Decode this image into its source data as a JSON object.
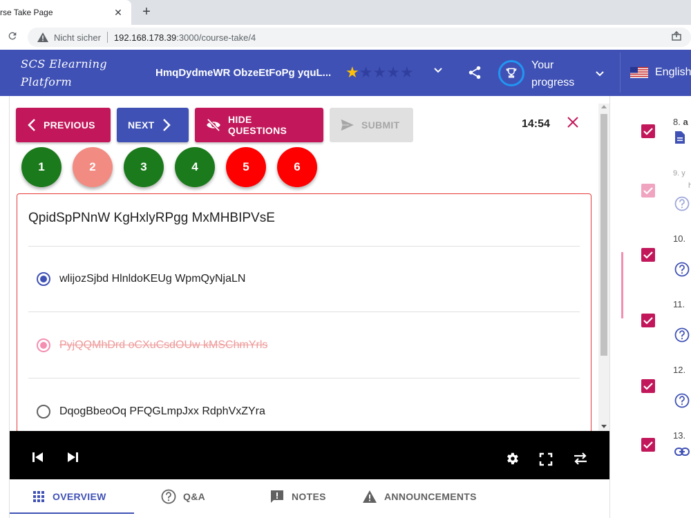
{
  "browser": {
    "tab_title": "rse Take Page",
    "tab_close": "✕",
    "new_tab": "+",
    "insecure_label": "Nicht sicher",
    "url_host": "192.168.178.39",
    "url_path": ":3000/course-take/4"
  },
  "header": {
    "logo_line1": "SCS Elearning",
    "logo_line2": "Platform",
    "course_title": "HmqDydmeWR ObzeEtFoPg yquL...",
    "rating": 1,
    "rating_max": 5,
    "progress_label": "Your progress",
    "language": "English",
    "colors": {
      "bar": "#3f51b5",
      "star_on": "#ffc107",
      "trophy_ring": "#2196f3"
    }
  },
  "toolbar": {
    "previous_label": "PREVIOUS",
    "next_label": "NEXT",
    "hide_questions_label": "HIDE QUESTIONS",
    "submit_label": "SUBMIT",
    "timer": "14:54"
  },
  "question_numbers": [
    {
      "label": "1",
      "status": "green"
    },
    {
      "label": "2",
      "status": "pink"
    },
    {
      "label": "3",
      "status": "green"
    },
    {
      "label": "4",
      "status": "green"
    },
    {
      "label": "5",
      "status": "red"
    },
    {
      "label": "6",
      "status": "red"
    }
  ],
  "question": {
    "title": "QpidSpPNnW KgHxlyRPgg MxMHBIPVsE",
    "answers": [
      {
        "text": "wlijozSjbd HlnldoKEUg WpmQyNjaLN",
        "state": "selected"
      },
      {
        "text": "PyjQQMhDrd oCXuCsdOUw kMSChmYrls",
        "state": "wrong"
      },
      {
        "text": "DqogBbeoOq PFQGLmpJxx RdphVxZYra",
        "state": "unselected"
      }
    ]
  },
  "bottom_tabs": [
    {
      "label": "OVERVIEW",
      "icon": "grid-icon",
      "active": true
    },
    {
      "label": "Q&A",
      "icon": "question-circle-icon",
      "active": false
    },
    {
      "label": "NOTES",
      "icon": "notes-icon",
      "active": false
    },
    {
      "label": "ANNOUNCEMENTS",
      "icon": "warning-icon",
      "active": false
    }
  ],
  "sidebar": {
    "items": [
      {
        "num": "8.",
        "extra": "a",
        "icon": "document-icon",
        "checked": true,
        "faded": false
      },
      {
        "num": "9.",
        "extra": "y",
        "extra2": "h",
        "icon": "question-circle-icon",
        "checked": true,
        "faded": true
      },
      {
        "num": "10.",
        "icon": "question-circle-icon",
        "checked": true,
        "faded": false
      },
      {
        "num": "11.",
        "icon": "question-circle-icon",
        "checked": true,
        "faded": false
      },
      {
        "num": "12.",
        "icon": "question-circle-icon",
        "checked": true,
        "faded": false
      },
      {
        "num": "13.",
        "icon": "link-icon",
        "checked": true,
        "faded": false
      }
    ]
  }
}
